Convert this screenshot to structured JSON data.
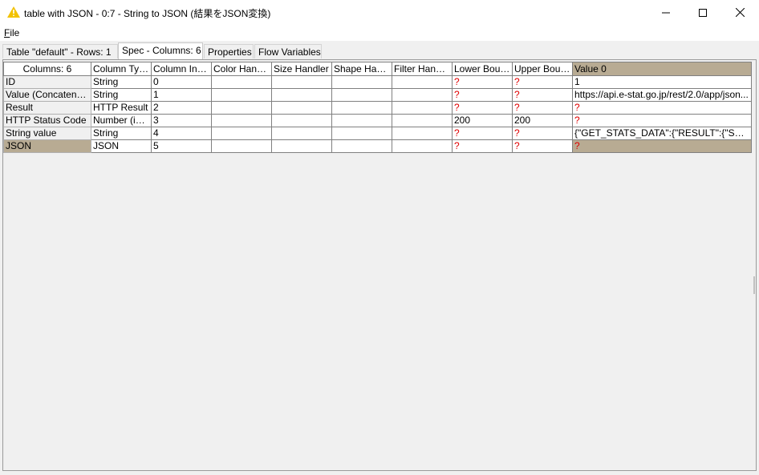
{
  "window": {
    "title": "table with JSON - 0:7 - String to JSON (結果をJSON変換)",
    "icon": "warning-triangle-icon",
    "controls": {
      "minimize": "minimize-icon",
      "maximize": "maximize-icon",
      "close": "close-icon"
    }
  },
  "menubar": {
    "file_mnemonic": "F",
    "file_rest": "ile"
  },
  "tabs": [
    {
      "label": "Table \"default\" - Rows: 1"
    },
    {
      "label": "Spec - Columns: 6"
    },
    {
      "label": "Properties"
    },
    {
      "label": "Flow Variables"
    }
  ],
  "active_tab": 1,
  "grid": {
    "corner_header": "Columns: 6",
    "headers": [
      "Column Type",
      "Column Index",
      "Color Handl...",
      "Size Handler",
      "Shape Hand...",
      "Filter Handl...",
      "Lower Bound",
      "Upper Bound",
      "Value 0"
    ],
    "rows": [
      {
        "name": "ID",
        "cells": [
          "String",
          "0",
          "",
          "",
          "",
          "",
          "?",
          "?",
          "1"
        ]
      },
      {
        "name": "Value (Concatenate)",
        "cells": [
          "String",
          "1",
          "",
          "",
          "",
          "",
          "?",
          "?",
          "https://api.e-stat.go.jp/rest/2.0/app/json..."
        ]
      },
      {
        "name": "Result",
        "cells": [
          "HTTP Result",
          "2",
          "",
          "",
          "",
          "",
          "?",
          "?",
          "?"
        ]
      },
      {
        "name": "HTTP Status Code",
        "cells": [
          "Number (inte...",
          "3",
          "",
          "",
          "",
          "",
          "200",
          "200",
          "?"
        ]
      },
      {
        "name": "String value",
        "cells": [
          "String",
          "4",
          "",
          "",
          "",
          "",
          "?",
          "?",
          "{\"GET_STATS_DATA\":{\"RESULT\":{\"STAT..."
        ]
      },
      {
        "name": "JSON",
        "cells": [
          "JSON",
          "5",
          "",
          "",
          "",
          "",
          "?",
          "?",
          "?"
        ]
      }
    ],
    "selected_row": 5,
    "missing_value_color": "#e00000",
    "selection_color": "#b8ab93"
  }
}
